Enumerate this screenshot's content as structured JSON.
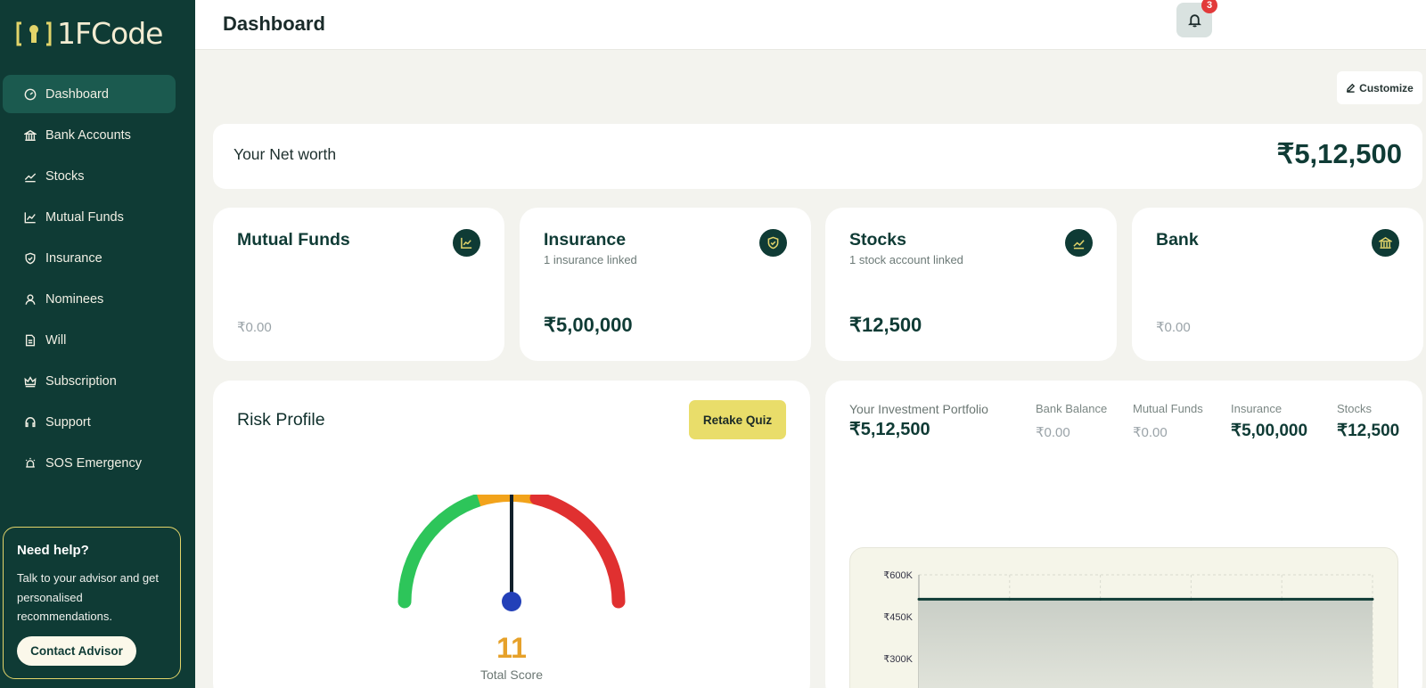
{
  "app": {
    "logo_text": "1FCode",
    "colors": {
      "brand": "#0f3b35",
      "accent": "#e9dd6a",
      "danger": "#e23a3a"
    }
  },
  "sidebar": {
    "items": [
      {
        "label": "Dashboard",
        "icon": "gauge-icon",
        "active": true
      },
      {
        "label": "Bank Accounts",
        "icon": "bank-icon"
      },
      {
        "label": "Stocks",
        "icon": "trend-icon"
      },
      {
        "label": "Mutual Funds",
        "icon": "chart-icon"
      },
      {
        "label": "Insurance",
        "icon": "shield-icon"
      },
      {
        "label": "Nominees",
        "icon": "user-icon"
      },
      {
        "label": "Will",
        "icon": "document-icon"
      },
      {
        "label": "Subscription",
        "icon": "crown-icon"
      },
      {
        "label": "Support",
        "icon": "headset-icon"
      },
      {
        "label": "SOS Emergency",
        "icon": "siren-icon"
      }
    ],
    "help": {
      "title": "Need help?",
      "text": "Talk to your advisor and get personalised recommendations.",
      "button": "Contact Advisor"
    }
  },
  "header": {
    "title": "Dashboard",
    "notification_count": "3"
  },
  "toolbar": {
    "customize_label": "Customize"
  },
  "networth": {
    "label": "Your Net worth",
    "value": "₹5,12,500"
  },
  "assets": [
    {
      "title": "Mutual Funds",
      "subtitle": "",
      "value": "₹0.00",
      "icon": "chart-icon"
    },
    {
      "title": "Insurance",
      "subtitle": "1 insurance linked",
      "value": "₹5,00,000",
      "icon": "shield-icon"
    },
    {
      "title": "Stocks",
      "subtitle": "1 stock account linked",
      "value": "₹12,500",
      "icon": "trend-icon"
    },
    {
      "title": "Bank",
      "subtitle": "",
      "value": "₹0.00",
      "icon": "bank-icon"
    }
  ],
  "risk": {
    "title": "Risk Profile",
    "button": "Retake Quiz",
    "score": "11",
    "score_label": "Total Score"
  },
  "portfolio": {
    "label": "Your Investment Portfolio",
    "value": "₹5,12,500",
    "breakdown": [
      {
        "label": "Bank Balance",
        "value": "₹0.00"
      },
      {
        "label": "Mutual Funds",
        "value": "₹0.00"
      },
      {
        "label": "Insurance",
        "value": "₹5,00,000"
      },
      {
        "label": "Stocks",
        "value": "₹12,500"
      }
    ]
  },
  "chart_data": {
    "type": "area",
    "x": [
      0,
      1,
      2,
      3,
      4,
      5
    ],
    "values": [
      512500,
      512500,
      512500,
      512500,
      512500,
      512500
    ],
    "ytick_labels": [
      "₹600K",
      "₹450K",
      "₹300K"
    ],
    "yticks": [
      600000,
      450000,
      300000
    ],
    "ylim": [
      300000,
      600000
    ],
    "grid": true
  }
}
